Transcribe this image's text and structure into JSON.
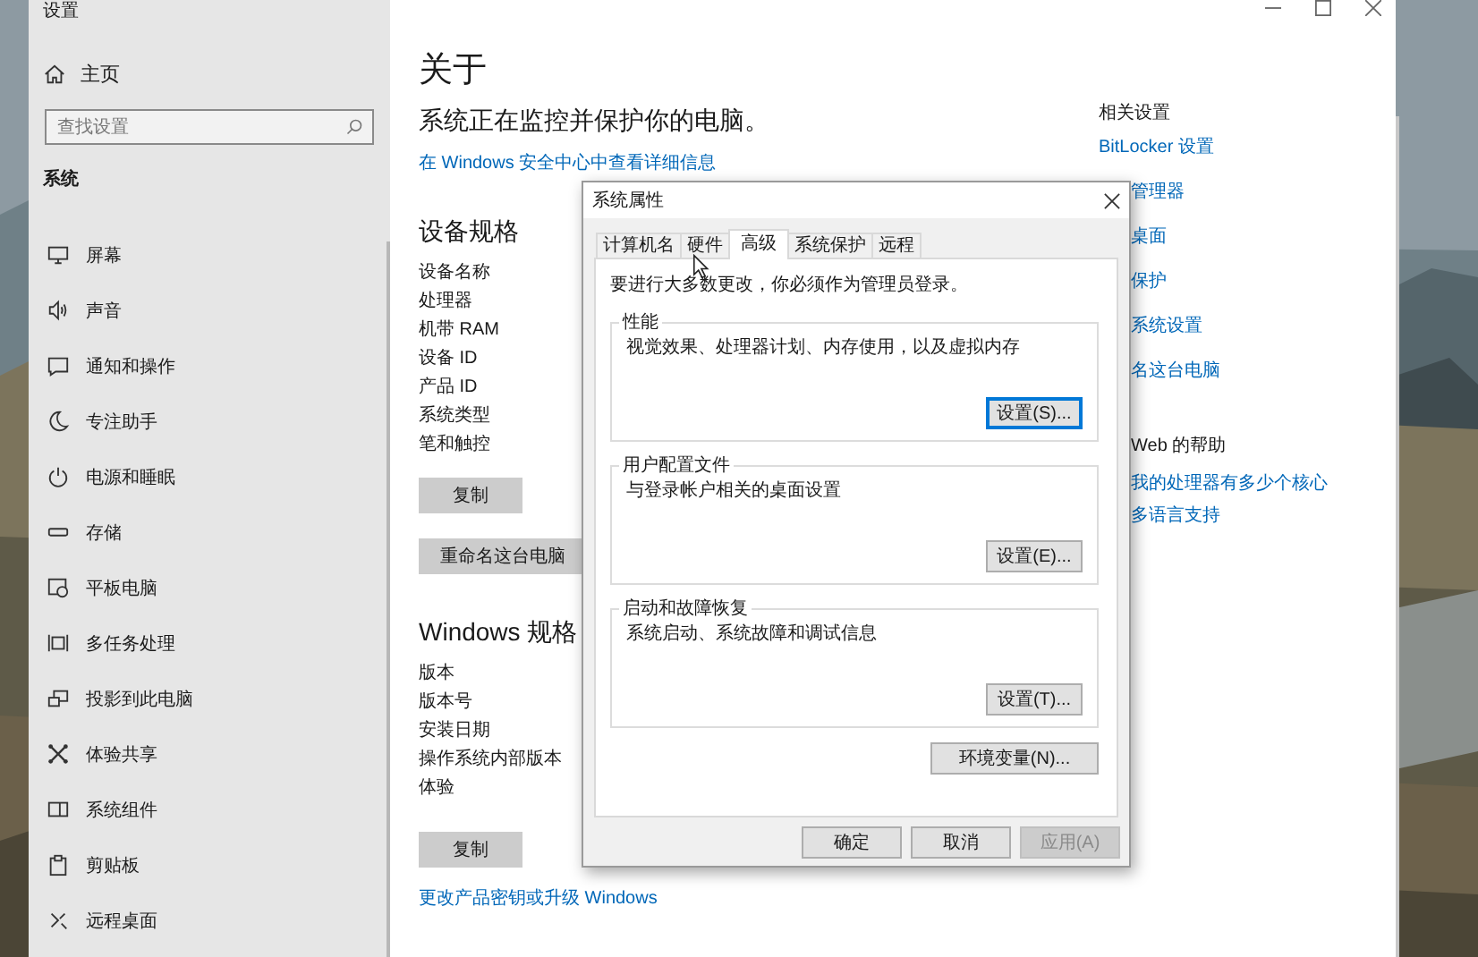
{
  "window": {
    "title": "设置"
  },
  "sidebar": {
    "home": "主页",
    "search": {
      "placeholder": "查找设置"
    },
    "section": "系统",
    "items": [
      {
        "label": "屏幕"
      },
      {
        "label": "声音"
      },
      {
        "label": "通知和操作"
      },
      {
        "label": "专注助手"
      },
      {
        "label": "电源和睡眠"
      },
      {
        "label": "存储"
      },
      {
        "label": "平板电脑"
      },
      {
        "label": "多任务处理"
      },
      {
        "label": "投影到此电脑"
      },
      {
        "label": "体验共享"
      },
      {
        "label": "系统组件"
      },
      {
        "label": "剪贴板"
      },
      {
        "label": "远程桌面"
      }
    ]
  },
  "page": {
    "title": "关于",
    "status": "系统正在监控并保护你的电脑。",
    "security_link": "在 Windows 安全中心中查看详细信息",
    "device_specs": {
      "title": "设备规格",
      "fields": [
        "设备名称",
        "处理器",
        "机带 RAM",
        "设备 ID",
        "产品 ID",
        "系统类型",
        "笔和触控"
      ],
      "buttons": [
        "复制",
        "重命名这台电脑"
      ]
    },
    "windows_specs": {
      "title": "Windows 规格",
      "fields": [
        "版本",
        "版本号",
        "安装日期",
        "操作系统内部版本",
        "体验"
      ],
      "buttons": [
        "复制"
      ]
    },
    "upgrade_link": "更改产品密钥或升级 Windows"
  },
  "related": {
    "title": "相关设置",
    "links": [
      "BitLocker 设置",
      "管理器",
      "桌面",
      "保护",
      "系统设置",
      "名这台电脑"
    ],
    "help_title": " Web 的帮助",
    "help_links": [
      "我的处理器有多少个核心",
      "多语言支持"
    ]
  },
  "dialog": {
    "title": "系统属性",
    "tabs": [
      {
        "label": "计算机名",
        "selected": false
      },
      {
        "label": "硬件",
        "selected": false
      },
      {
        "label": "高级",
        "selected": true
      },
      {
        "label": "系统保护",
        "selected": false
      },
      {
        "label": "远程",
        "selected": false
      }
    ],
    "notice": "要进行大多数更改，你必须作为管理员登录。",
    "groups": [
      {
        "title": "性能",
        "description": "视觉效果、处理器计划、内存使用，以及虚拟内存",
        "button": {
          "label": "设置(S)...",
          "focused": true
        }
      },
      {
        "title": "用户配置文件",
        "description": "与登录帐户相关的桌面设置",
        "button": {
          "label": "设置(E)...",
          "focused": false
        }
      },
      {
        "title": "启动和故障恢复",
        "description": "系统启动、系统故障和调试信息",
        "button": {
          "label": "设置(T)...",
          "focused": false
        }
      }
    ],
    "env_button": "环境变量(N)...",
    "buttons": [
      {
        "label": "确定",
        "disabled": false
      },
      {
        "label": "取消",
        "disabled": false
      },
      {
        "label": "应用(A)",
        "disabled": true
      }
    ]
  }
}
